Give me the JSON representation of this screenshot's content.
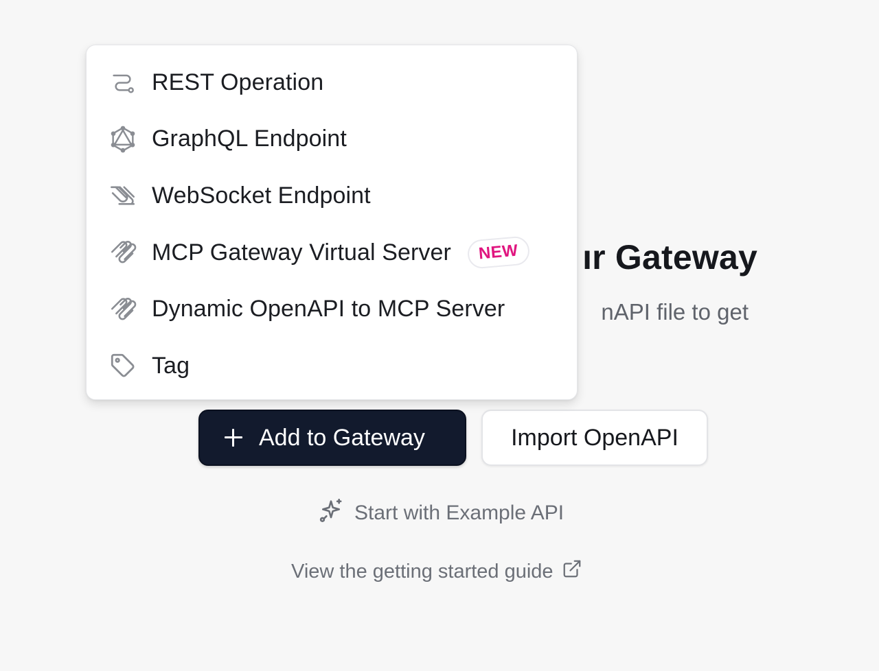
{
  "empty_state": {
    "title_visible": "ır Gateway",
    "subtitle_visible": "nAPI file to get"
  },
  "actions": {
    "add_label": "Add to Gateway",
    "import_label": "Import OpenAPI"
  },
  "links": {
    "example_label": "Start with Example API",
    "guide_label": "View the getting started guide"
  },
  "menu": {
    "items": [
      {
        "label": "REST Operation",
        "icon": "route-icon"
      },
      {
        "label": "GraphQL Endpoint",
        "icon": "graphql-icon"
      },
      {
        "label": "WebSocket Endpoint",
        "icon": "websocket-icon"
      },
      {
        "label": "MCP Gateway Virtual Server",
        "icon": "mcp-icon",
        "badge": "NEW"
      },
      {
        "label": "Dynamic OpenAPI to MCP Server",
        "icon": "mcp-icon"
      },
      {
        "label": "Tag",
        "icon": "tag-icon"
      }
    ]
  },
  "colors": {
    "primary_button": "#121a2d",
    "badge_text": "#e0157f",
    "muted_text": "#6b6f77",
    "background": "#f7f7f7"
  }
}
